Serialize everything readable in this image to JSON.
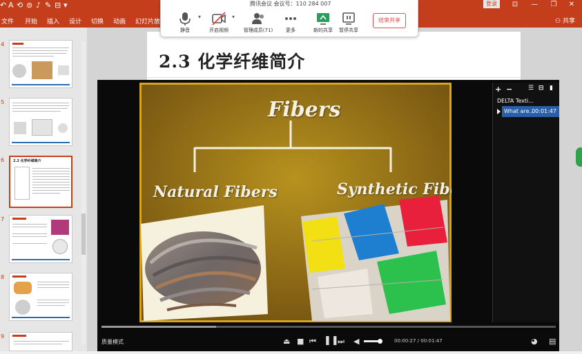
{
  "app": {
    "title_bar_buttons": {
      "login": "登录"
    },
    "ribbon_tabs": [
      "文件",
      "开始",
      "插入",
      "设计",
      "切换",
      "动画",
      "幻灯片放映"
    ],
    "share_label": "共享",
    "qat_icons": [
      "undo-icon",
      "font-icon",
      "format-painter-icon",
      "redo-icon",
      "mic-icon",
      "pen-icon",
      "more-icon"
    ]
  },
  "thumbnails": [
    {
      "number": "4",
      "selected": false
    },
    {
      "number": "5",
      "selected": false
    },
    {
      "number": "6",
      "selected": true,
      "caption": "2.3 化学纤维简介"
    },
    {
      "number": "7",
      "selected": false
    },
    {
      "number": "8",
      "selected": false
    },
    {
      "number": "9",
      "selected": false
    }
  ],
  "slide": {
    "title": "2.3 化学纤维简介"
  },
  "meeting": {
    "info": "腾讯会议 会议号：110 284 007",
    "buttons": [
      {
        "id": "mute",
        "label": "静音"
      },
      {
        "id": "video",
        "label": "开启视频"
      },
      {
        "id": "members",
        "label": "管理成员(71)"
      },
      {
        "id": "more",
        "label": "更多"
      },
      {
        "id": "new-share",
        "label": "新的共享"
      },
      {
        "id": "pause-share",
        "label": "暂停共享"
      }
    ],
    "end_share": "结束共享"
  },
  "player": {
    "playlist": [
      {
        "title": "DELTA Texti...",
        "duration": ""
      },
      {
        "title": "What are...",
        "duration": "00:01:47",
        "active": true
      }
    ],
    "quality_mode": "质量模式",
    "current_time": "00:00:27",
    "total_time": "00:01:47",
    "time_display": "00:00:27 / 00:01:47",
    "progress": 0.252,
    "volume": 0.9
  },
  "video_frame": {
    "heading": "Fibers",
    "left_branch": "Natural Fibers",
    "right_branch": "Synthetic Fibers"
  },
  "colors": {
    "ppt_accent": "#c43e1c",
    "meeting_end": "#e05050",
    "playlist_active": "#2b5ea8",
    "video_bg": "#a88420"
  }
}
